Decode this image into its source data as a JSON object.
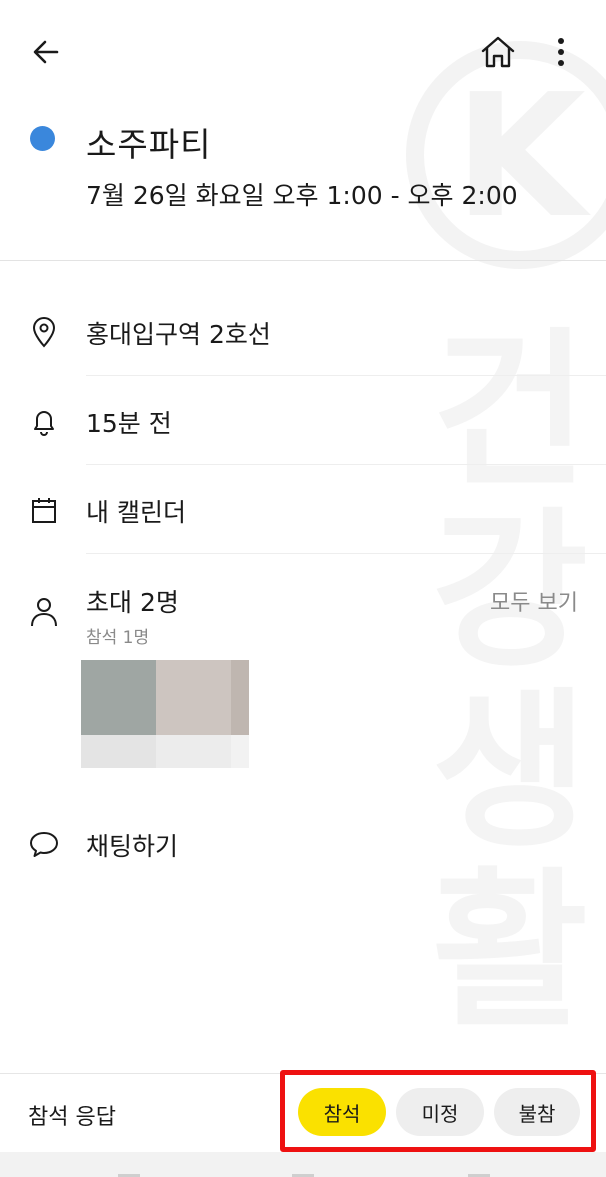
{
  "watermark": {
    "logo_letter": "K",
    "chars": [
      "건",
      "강",
      "생",
      "활"
    ]
  },
  "header": {
    "title": "소주파티",
    "calendar_color": "#3a87dc",
    "datetime": "7월 26일 화요일  오후 1:00 - 오후 2:00"
  },
  "details": {
    "location": "홍대입구역 2호선",
    "reminder": "15분 전",
    "calendar": "내 캘린더"
  },
  "invitees": {
    "title": "초대 2명",
    "attending": "참석 1명",
    "see_all": "모두 보기"
  },
  "chat": {
    "label": "채팅하기"
  },
  "rsvp": {
    "label": "참석 응답",
    "accept": "참석",
    "maybe": "미정",
    "decline": "불참",
    "selected": "참석",
    "accent": "#fae100",
    "highlight": "#ee1111"
  },
  "icons": {
    "back": "arrow-left-icon",
    "home": "home-icon",
    "more": "more-vertical-icon",
    "location": "location-pin-icon",
    "reminder": "bell-icon",
    "calendar": "calendar-icon",
    "person": "person-icon",
    "chat": "chat-bubble-icon"
  }
}
